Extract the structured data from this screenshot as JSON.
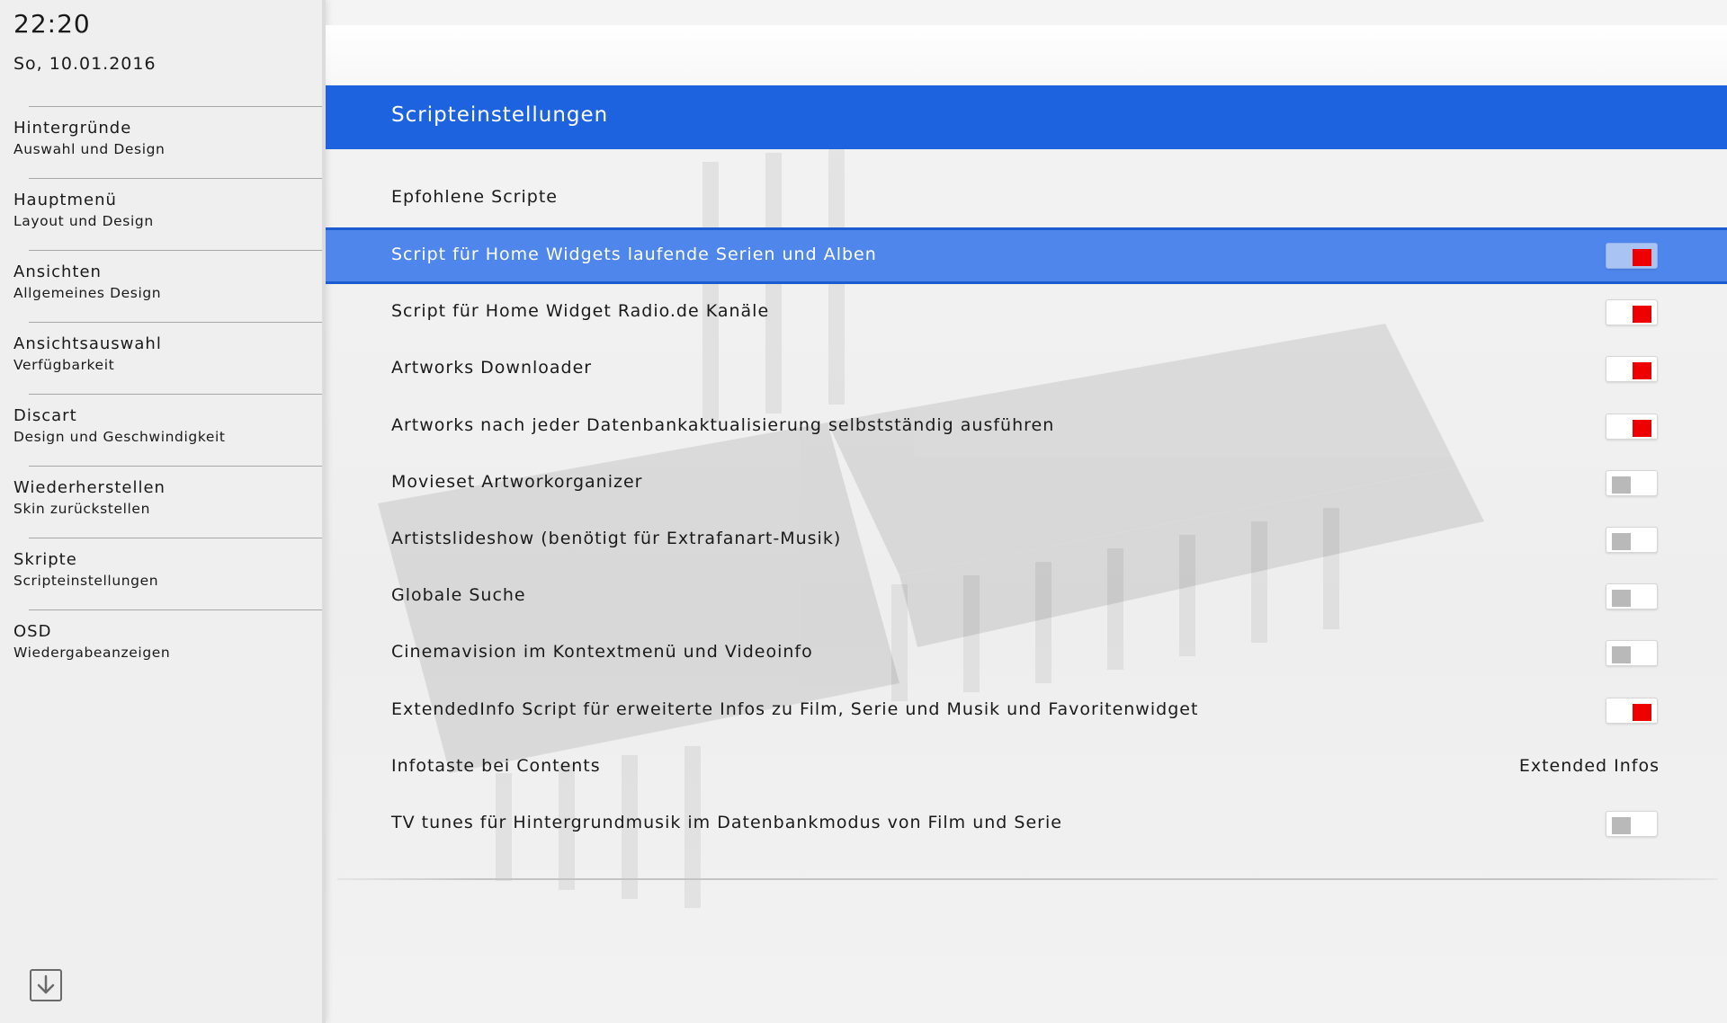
{
  "sidebar": {
    "clock": "22:20",
    "date": "So, 10.01.2016",
    "items": [
      {
        "title": "Hintergründe",
        "subtitle": "Auswahl und Design"
      },
      {
        "title": "Hauptmenü",
        "subtitle": "Layout und Design"
      },
      {
        "title": "Ansichten",
        "subtitle": "Allgemeines Design"
      },
      {
        "title": "Ansichtsauswahl",
        "subtitle": "Verfügbarkeit"
      },
      {
        "title": "Discart",
        "subtitle": "Design und Geschwindigkeit"
      },
      {
        "title": "Wiederherstellen",
        "subtitle": "Skin zurückstellen"
      },
      {
        "title": "Skripte",
        "subtitle": "Scripteinstellungen"
      },
      {
        "title": "OSD",
        "subtitle": "Wiedergabeanzeigen"
      }
    ],
    "down_icon": "arrow-down-icon"
  },
  "header": {
    "title": "Scripteinstellungen"
  },
  "section": {
    "label": "Epfohlene Scripte"
  },
  "settings": [
    {
      "label": "Script für Home Widgets laufende Serien und Alben",
      "type": "toggle",
      "enabled": true,
      "selected": true
    },
    {
      "label": "Script für Home Widget Radio.de Kanäle",
      "type": "toggle",
      "enabled": true,
      "selected": false
    },
    {
      "label": "Artworks Downloader",
      "type": "toggle",
      "enabled": true,
      "selected": false
    },
    {
      "label": "Artworks nach jeder Datenbankaktualisierung selbstständig ausführen",
      "type": "toggle",
      "enabled": true,
      "selected": false
    },
    {
      "label": "Movieset Artworkorganizer",
      "type": "toggle",
      "enabled": false,
      "selected": false
    },
    {
      "label": "Artistslideshow (benötigt für Extrafanart-Musik)",
      "type": "toggle",
      "enabled": false,
      "selected": false
    },
    {
      "label": "Globale Suche",
      "type": "toggle",
      "enabled": false,
      "selected": false
    },
    {
      "label": "Cinemavision im Kontextmenü und Videoinfo",
      "type": "toggle",
      "enabled": false,
      "selected": false
    },
    {
      "label": "ExtendedInfo Script für erweiterte Infos zu Film, Serie und Musik und Favoritenwidget",
      "type": "toggle",
      "enabled": true,
      "selected": false
    },
    {
      "label": "Infotaste bei Contents",
      "type": "value",
      "value": "Extended Infos",
      "selected": false
    },
    {
      "label": "TV tunes für Hintergrundmusik im Datenbankmodus von Film und Serie",
      "type": "toggle",
      "enabled": false,
      "selected": false
    }
  ],
  "colors": {
    "accent": "#1d63e0",
    "selected_row": "#4f86ec",
    "toggle_on": "#ee0000",
    "toggle_off": "#b9b9b9"
  }
}
